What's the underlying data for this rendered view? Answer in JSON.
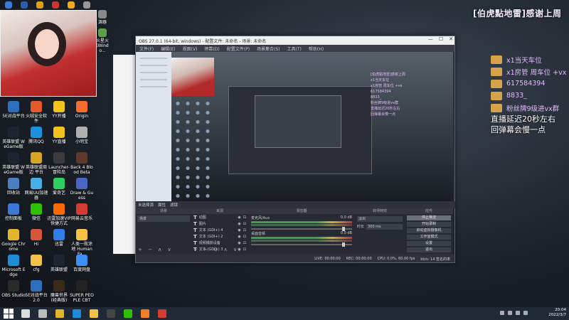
{
  "desktop": {
    "top_icons": [
      {
        "label": "",
        "color": "#3a7bd5"
      },
      {
        "label": "",
        "color": "#2b5da8"
      },
      {
        "label": "",
        "color": "#e0a010"
      },
      {
        "label": "",
        "color": "#cc3333"
      },
      {
        "label": "",
        "color": "#f2a81d"
      },
      {
        "label": "源器",
        "color": "#999999"
      }
    ],
    "right_top_icons": [
      {
        "label": "源器",
        "color": "#888888"
      },
      {
        "label": "火星火 (Windo...",
        "color": "#5ea04a"
      }
    ],
    "icons": [
      {
        "label": "5E对战平台",
        "color": "#2c6fbd"
      },
      {
        "label": "火绒安全软件",
        "color": "#e55a2a"
      },
      {
        "label": "YY开播",
        "color": "#f3c21b"
      },
      {
        "label": "Origin",
        "color": "#f56c2d"
      },
      {
        "label": "英雄联盟 WeGame版",
        "color": "#1d2533"
      },
      {
        "label": "腾讯QQ",
        "color": "#1f8fe0"
      },
      {
        "label": "YY直播",
        "color": "#f3c21b"
      },
      {
        "label": "小明宝",
        "color": "#b0b0b0"
      },
      {
        "label": "英雄联盟 WeGame版",
        "color": "#1d2533"
      },
      {
        "label": "英雄联盟周边 平台",
        "color": "#d5a526"
      },
      {
        "label": "Launcher-冒险岛",
        "color": "#3b3b3b"
      },
      {
        "label": "Back 4 Blood Beta",
        "color": "#5b3a2a"
      },
      {
        "label": "回收站",
        "color": "#4c7fc0"
      },
      {
        "label": "网易UU加速器",
        "color": "#46b0e6"
      },
      {
        "label": "爱奇艺",
        "color": "#2ccf60"
      },
      {
        "label": "Draw & Guess",
        "color": "#4a66c2"
      },
      {
        "label": "控制面板",
        "color": "#3b78d8"
      },
      {
        "label": "微信",
        "color": "#2dc100"
      },
      {
        "label": "迅雷加速VIP 快捷方式",
        "color": "#ff6a00"
      },
      {
        "label": "网易云音乐",
        "color": "#d43c33"
      },
      {
        "label": "Google Chrome",
        "color": "#e3b52d"
      },
      {
        "label": "Hi",
        "color": "#d4573a"
      },
      {
        "label": "迅雷",
        "color": "#2f7fe6"
      },
      {
        "label": "人类一败涂地 Human Fa...",
        "color": "#f7c347"
      },
      {
        "label": "Microsoft Edge",
        "color": "#1f8dd6"
      },
      {
        "label": "cfg",
        "color": "#f1c24a"
      },
      {
        "label": "英雄联盟",
        "color": "#1d2533"
      },
      {
        "label": "百度网盘",
        "color": "#3d8ef5"
      },
      {
        "label": "OBS Studio",
        "color": "#2b2b2b"
      },
      {
        "label": "5E对战平台 2.0",
        "color": "#2c6fbd"
      },
      {
        "label": "魔兽世界 (经典版)",
        "color": "#3a2a1a"
      },
      {
        "label": "SUPER PEOPLE CBT",
        "color": "#222222"
      }
    ]
  },
  "overlay": {
    "title": "[伯虎點地雷]感谢上周",
    "lines": [
      {
        "text": "x1当天车位"
      },
      {
        "text": "x1房管 周车位 +vx"
      },
      {
        "text": "617584394"
      },
      {
        "text": "8833_"
      },
      {
        "text": "粉丝牌9级进vx群"
      }
    ],
    "delay_line1": "直播延迟20秒左右",
    "delay_line2": "回弹幕会慢一点"
  },
  "obs": {
    "title": "OBS 27.0.1 (64-bit, windows) - 配置文件: 未命名 - 场景: 未命名",
    "menu": [
      "文件(F)",
      "编辑(E)",
      "视图(V)",
      "停靠(D)",
      "配置文件(P)",
      "场景集合(S)",
      "工具(T)",
      "帮助(H)"
    ],
    "win_min": "—",
    "win_max": "☐",
    "win_close": "✕",
    "docks_header_label": "未选择源",
    "docks_header_props": "属性",
    "docks_header_filters": "滤镜",
    "scenes_title": "场景",
    "scenes": [
      "场景"
    ],
    "sources_title": "来源",
    "sources": [
      {
        "label": "动图"
      },
      {
        "label": "图片"
      },
      {
        "label": "文本 (GDI+) 4"
      },
      {
        "label": "文本 (GDI+) 2"
      },
      {
        "label": "视频捕获设备"
      },
      {
        "label": "文本 (GDI+) 3"
      }
    ],
    "mixer_title": "混音器",
    "mixer": [
      {
        "name": "麦克风/Aux",
        "db": "0.0 dB"
      },
      {
        "name": "桌面音频",
        "db": "0.0 dB"
      }
    ],
    "trans_title": "转场特效",
    "trans_select": "淡出",
    "trans_duration_label": "时长",
    "trans_duration": "300 ms",
    "controls_title": "控件",
    "controls": [
      {
        "label": "停止推流",
        "highlight": true
      },
      {
        "label": "开始录制",
        "highlight": false
      },
      {
        "label": "启动虚拟摄像机",
        "highlight": false
      },
      {
        "label": "工作室模式",
        "highlight": false
      },
      {
        "label": "设置",
        "highlight": false
      },
      {
        "label": "退出",
        "highlight": false
      }
    ],
    "status": {
      "live": "LIVE: 00:00:00",
      "rec": "REC: 00:00:00",
      "cpu": "CPU: 0.0%, 60.00 fps",
      "bitrate": "kb/s: 14 签名的率"
    },
    "preview_text": [
      "[伯虎點地雷]感谢上周",
      "x1当天车位",
      "x1房管 周车位 +vx",
      "617584394",
      "8833_",
      "粉丝牌9级进vx群",
      "直播延迟20秒左右",
      "回弹幕会慢一点"
    ]
  },
  "taskbar": {
    "apps": [
      {
        "name": "search-icon",
        "color": "#dddddd"
      },
      {
        "name": "task-view-icon",
        "color": "#bbbbbb"
      },
      {
        "name": "chrome-icon",
        "color": "#e3b52d"
      },
      {
        "name": "edge-icon",
        "color": "#1f8dd6"
      },
      {
        "name": "explorer-icon",
        "color": "#f1c24a"
      },
      {
        "name": "obs-icon",
        "color": "#444444"
      },
      {
        "name": "wechat-icon",
        "color": "#2dc100"
      },
      {
        "name": "app-icon",
        "color": "#f07f2a"
      },
      {
        "name": "netease-icon",
        "color": "#d43c33"
      }
    ],
    "time": "20:04",
    "date": "2022/3/7"
  }
}
